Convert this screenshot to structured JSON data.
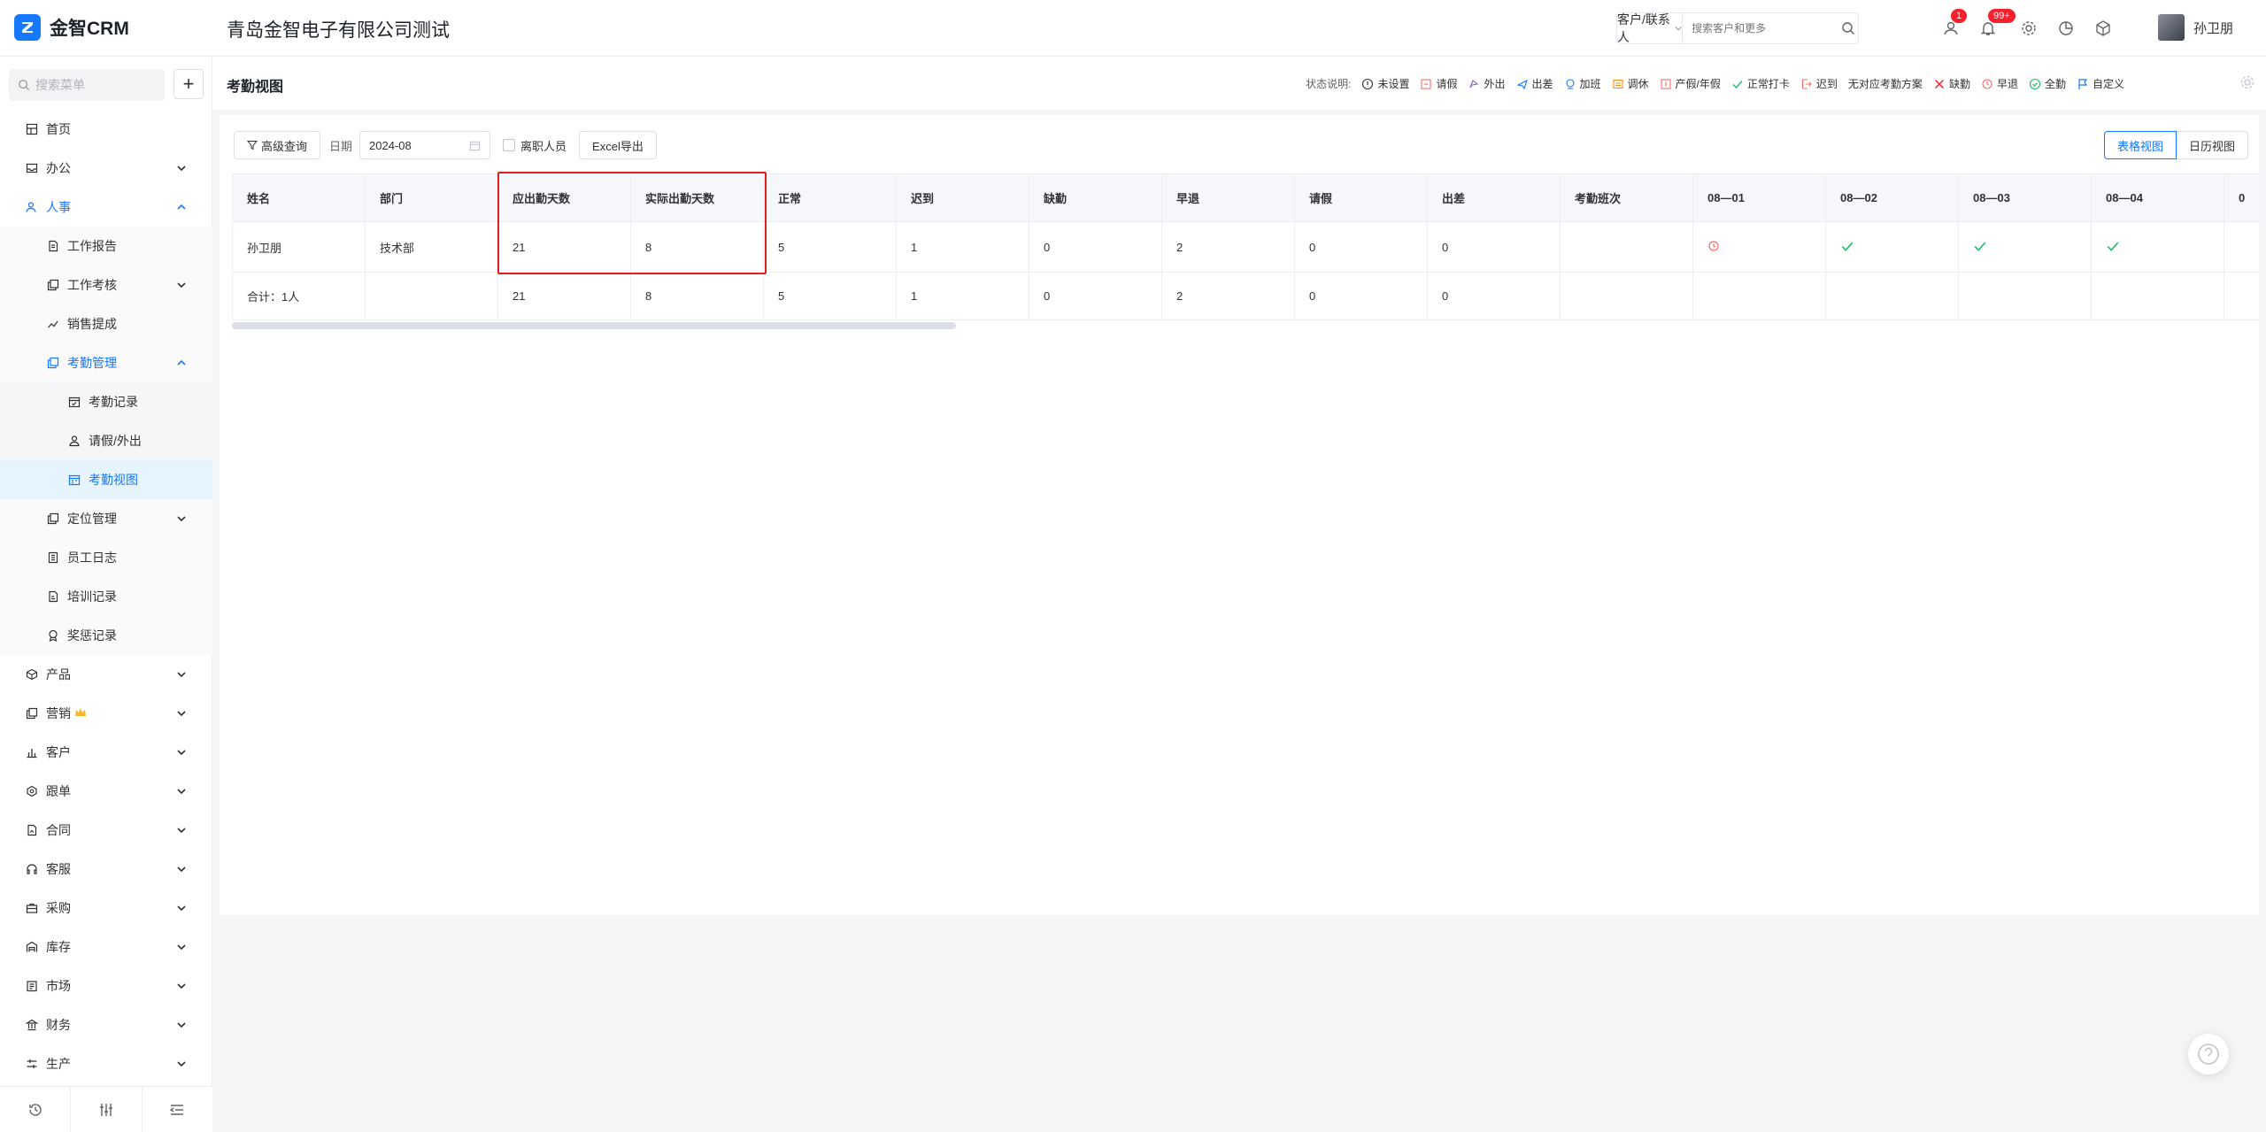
{
  "app": {
    "logo_text": "金智CRM",
    "company": "青岛金智电子有限公司测试"
  },
  "header": {
    "search_type": "客户/联系人",
    "search_placeholder": "搜索客户和更多",
    "contact_badge": "1",
    "bell_badge": "99+",
    "user_name": "孙卫朋"
  },
  "sidebar": {
    "search_placeholder": "搜索菜单",
    "items": [
      {
        "label": "首页"
      },
      {
        "label": "办公"
      },
      {
        "label": "人事"
      },
      {
        "label": "工作报告"
      },
      {
        "label": "工作考核"
      },
      {
        "label": "销售提成"
      },
      {
        "label": "考勤管理"
      },
      {
        "label": "考勤记录"
      },
      {
        "label": "请假/外出"
      },
      {
        "label": "考勤视图"
      },
      {
        "label": "定位管理"
      },
      {
        "label": "员工日志"
      },
      {
        "label": "培训记录"
      },
      {
        "label": "奖惩记录"
      },
      {
        "label": "产品"
      },
      {
        "label": "营销"
      },
      {
        "label": "客户"
      },
      {
        "label": "跟单"
      },
      {
        "label": "合同"
      },
      {
        "label": "客服"
      },
      {
        "label": "采购"
      },
      {
        "label": "库存"
      },
      {
        "label": "市场"
      },
      {
        "label": "财务"
      },
      {
        "label": "生产"
      }
    ]
  },
  "page": {
    "title": "考勤视图",
    "legend_title": "状态说明:",
    "legend": [
      "未设置",
      "请假",
      "外出",
      "出差",
      "加班",
      "调休",
      "产假/年假",
      "正常打卡",
      "迟到",
      "无对应考勤方案",
      "缺勤",
      "早退",
      "全勤",
      "自定义"
    ]
  },
  "toolbar": {
    "advanced_query": "高级查询",
    "date_label": "日期",
    "date_value": "2024-08",
    "resigned_label": "离职人员",
    "export_label": "Excel导出",
    "view_table": "表格视图",
    "view_calendar": "日历视图"
  },
  "table": {
    "headers": [
      "姓名",
      "部门",
      "应出勤天数",
      "实际出勤天数",
      "正常",
      "迟到",
      "缺勤",
      "早退",
      "请假",
      "出差",
      "考勤班次",
      "08—01",
      "08—02",
      "08—03",
      "08—04",
      "0"
    ],
    "rows": [
      {
        "name": "孙卫朋",
        "dept": "技术部",
        "due": "21",
        "actual": "8",
        "normal": "5",
        "late": "1",
        "absent": "0",
        "early": "2",
        "leave": "0",
        "trip": "0",
        "shift": ""
      }
    ],
    "summary": {
      "label": "合计：1人",
      "due": "21",
      "actual": "8",
      "normal": "5",
      "late": "1",
      "absent": "0",
      "early": "2",
      "leave": "0",
      "trip": "0"
    }
  },
  "colors": {
    "accent": "#1677ff",
    "highlight": "#e02020",
    "ok": "#19be6b",
    "late": "#f56c6c"
  }
}
